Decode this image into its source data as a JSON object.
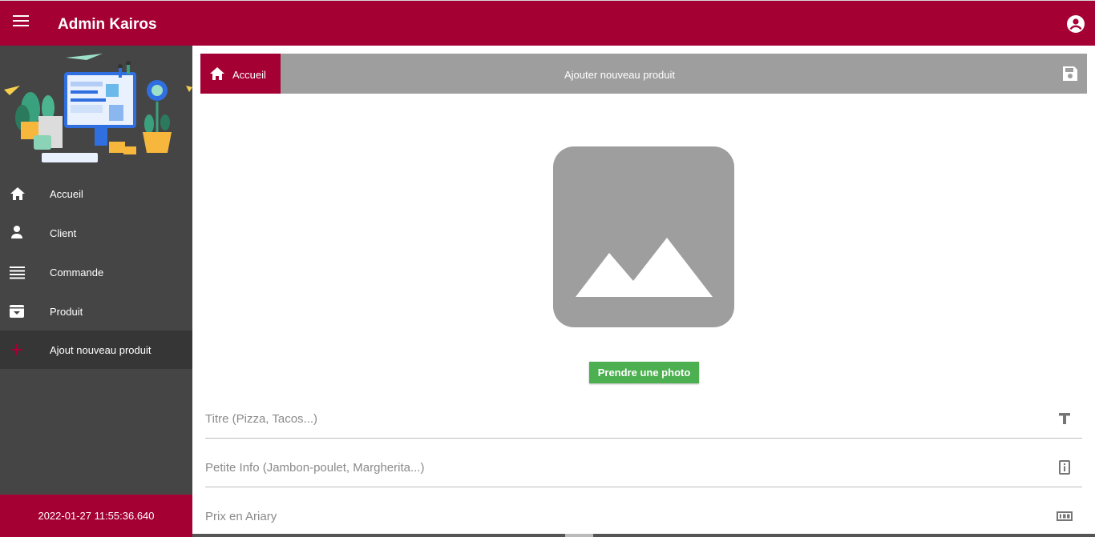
{
  "app": {
    "title": "Admin Kairos"
  },
  "sidebar": {
    "items": [
      {
        "label": "Accueil",
        "icon": "home-icon"
      },
      {
        "label": "Client",
        "icon": "person-icon"
      },
      {
        "label": "Commande",
        "icon": "list-icon"
      },
      {
        "label": "Produit",
        "icon": "archive-icon"
      },
      {
        "label": "Ajout nouveau produit",
        "icon": "plus-icon",
        "active": true
      }
    ],
    "timestamp": "2022-01-27 11:55:36.640"
  },
  "breadcrumb": {
    "home_label": "Accueil",
    "page_title": "Ajouter nouveau produit"
  },
  "form": {
    "photo_button": "Prendre une photo",
    "title_placeholder": "Titre (Pizza, Tacos...)",
    "info_placeholder": "Petite Info (Jambon-poulet, Margherita...)",
    "price_placeholder": "Prix en Ariary"
  },
  "colors": {
    "brand": "#a50034",
    "sidebar": "#454545",
    "breadcrumb": "#9e9e9e",
    "photo_button": "#4caf50"
  }
}
